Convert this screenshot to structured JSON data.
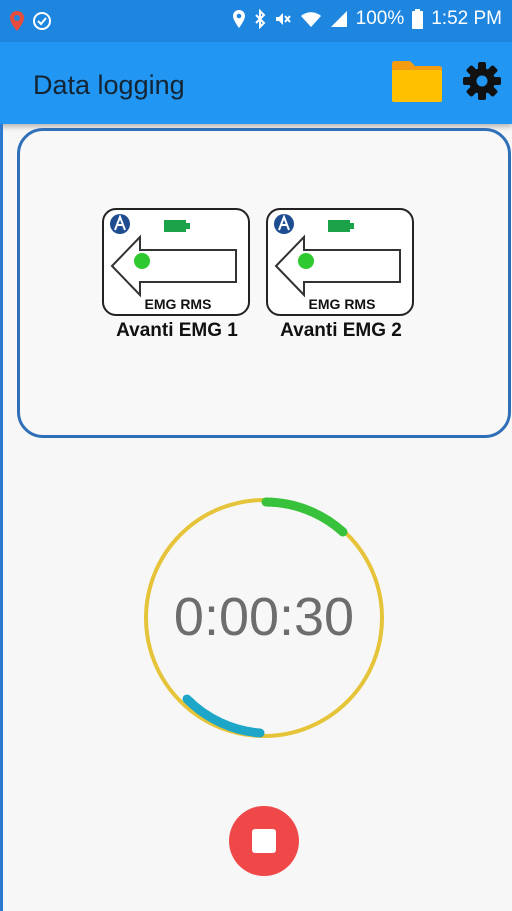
{
  "status_bar": {
    "battery_text": "100%",
    "time": "1:52 PM"
  },
  "app_bar": {
    "title": "Data logging",
    "folder_icon": "folder-icon",
    "settings_icon": "gear-icon"
  },
  "sensors": [
    {
      "name": "Avanti EMG 1",
      "mode": "EMG RMS",
      "connected": true,
      "battery": "full"
    },
    {
      "name": "Avanti EMG 2",
      "mode": "EMG RMS",
      "connected": true,
      "battery": "full"
    }
  ],
  "timer": {
    "elapsed": "0:00:30"
  },
  "colors": {
    "primary": "#2196f3",
    "panel_border": "#2f6fb8",
    "ring": "#e6c43a",
    "ring_green": "#38c13a",
    "ring_blue": "#1ea6c9",
    "stop": "#f04848"
  },
  "controls": {
    "stop_icon": "stop-icon"
  }
}
